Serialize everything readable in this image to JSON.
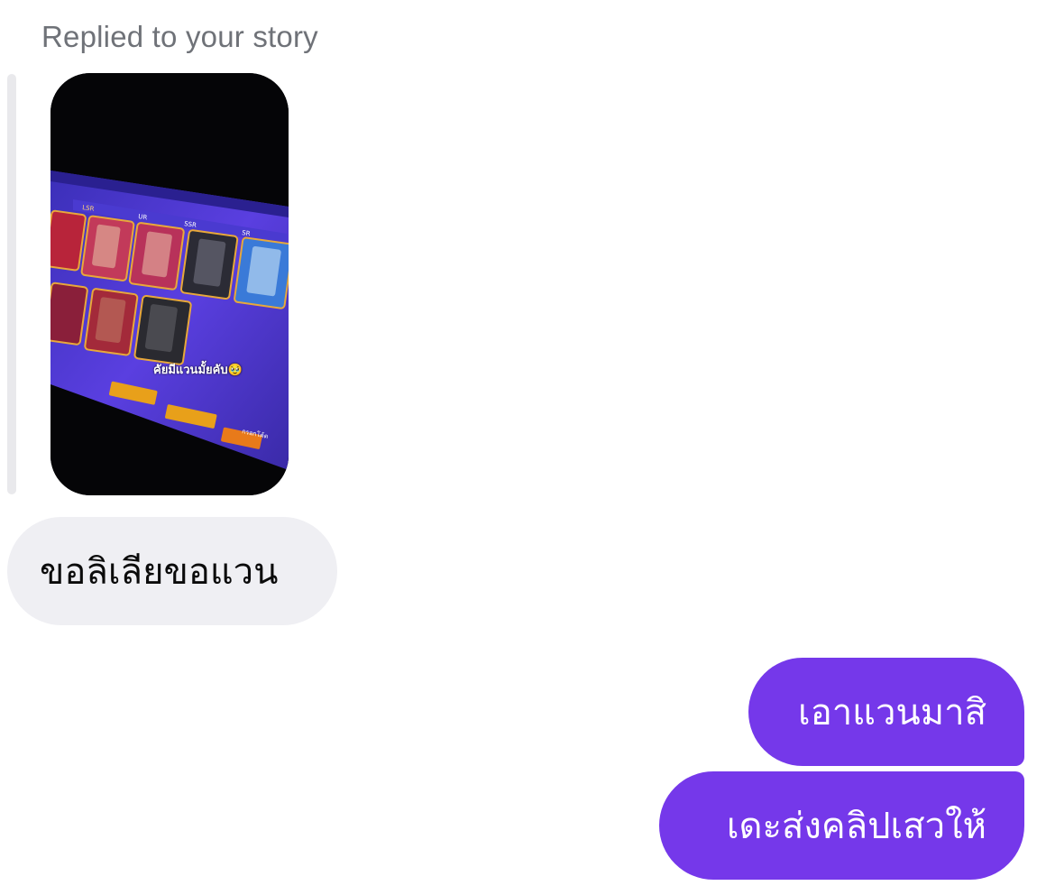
{
  "reply_context": {
    "label": "Replied to your story"
  },
  "story": {
    "caption": "คัยมีแวนมั้ยคับ🥹",
    "tier_tabs": [
      "LSR",
      "UR",
      "SSR",
      "SR"
    ],
    "buttons": [
      "",
      "",
      "กรอกโค้ด"
    ]
  },
  "messages": [
    {
      "direction": "incoming",
      "text": "ขอลิเลียขอแวน"
    },
    {
      "direction": "outgoing",
      "text": "เอาแวนมาสิ"
    },
    {
      "direction": "outgoing",
      "text": "เดะส่งคลิปเสวให้"
    }
  ],
  "colors": {
    "outgoing_bubble": "#7538ea",
    "incoming_bubble": "#efeff3",
    "header_text": "#6f7278"
  }
}
